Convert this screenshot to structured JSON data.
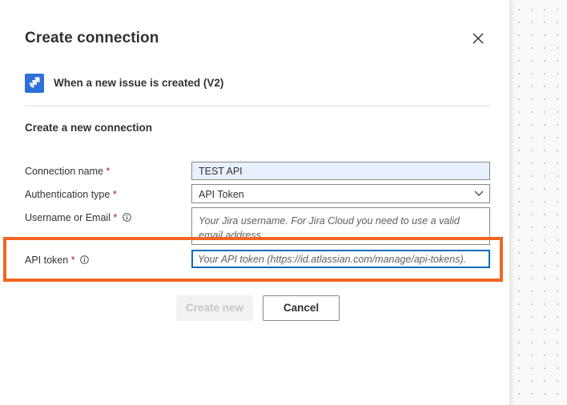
{
  "dialog": {
    "title": "Create connection",
    "trigger": {
      "icon": "jira-icon",
      "title": "When a new issue is created (V2)"
    },
    "section_title": "Create a new connection"
  },
  "fields": {
    "connection_name": {
      "label": "Connection name",
      "required_mark": "*",
      "value": "TEST API"
    },
    "auth_type": {
      "label": "Authentication type",
      "required_mark": "*",
      "value": "API Token"
    },
    "username": {
      "label": "Username or Email",
      "required_mark": "*",
      "placeholder": "Your Jira username. For Jira Cloud you need to use a valid email address."
    },
    "api_token": {
      "label": "API token",
      "required_mark": "*",
      "placeholder": "Your API token (https://id.atlassian.com/manage/api-tokens)."
    }
  },
  "buttons": {
    "create_new": "Create new",
    "cancel": "Cancel"
  },
  "colors": {
    "highlight": "#f26522",
    "required": "#a4262c",
    "jira_blue": "#2f6fd9",
    "focus_border": "#0f6cbd"
  }
}
